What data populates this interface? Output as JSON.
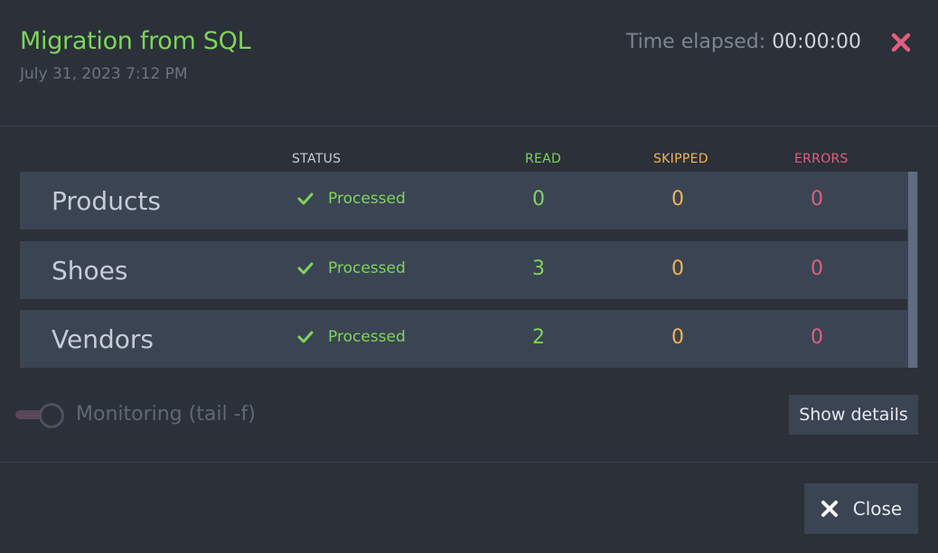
{
  "header": {
    "title": "Migration from SQL",
    "date": "July 31, 2023 7:12 PM",
    "elapsed_label": "Time elapsed:",
    "elapsed_value": "00:00:00"
  },
  "columns": {
    "status": "STATUS",
    "read": "READ",
    "skipped": "SKIPPED",
    "errors": "ERRORS"
  },
  "rows": [
    {
      "name": "Products",
      "status": "Processed",
      "read": "0",
      "skipped": "0",
      "errors": "0"
    },
    {
      "name": "Shoes",
      "status": "Processed",
      "read": "3",
      "skipped": "0",
      "errors": "0"
    },
    {
      "name": "Vendors",
      "status": "Processed",
      "read": "2",
      "skipped": "0",
      "errors": "0"
    }
  ],
  "monitoring": {
    "label": "Monitoring (tail -f)",
    "enabled": false
  },
  "buttons": {
    "show_details": "Show details",
    "close": "Close"
  },
  "icons": {
    "header_close": "close-icon",
    "status": "check-icon",
    "close_button": "close-icon"
  },
  "colors": {
    "success": "#7dd55a",
    "warning": "#f0b35b",
    "error": "#e05f7e",
    "close_x": "#e05f7e"
  }
}
